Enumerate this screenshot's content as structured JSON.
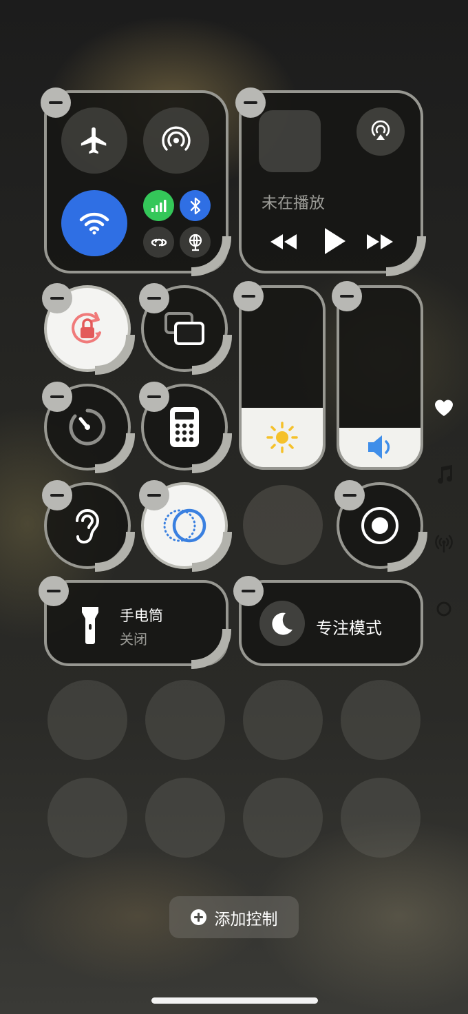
{
  "media": {
    "now_playing": "未在播放"
  },
  "flashlight": {
    "title": "手电筒",
    "status": "关闭"
  },
  "focus": {
    "title": "专注模式"
  },
  "add_control": {
    "label": "添加控制"
  },
  "sliders": {
    "brightness_level": 0.33,
    "volume_level": 0.22
  },
  "icons": {
    "airplane": "airplane-icon",
    "airdrop": "airdrop-icon",
    "wifi": "wifi-icon",
    "cellular": "cellular-signal-icon",
    "bluetooth": "bluetooth-icon",
    "link": "chain-link-icon",
    "satellite": "satellite-globe-icon",
    "airplay": "airplay-audio-icon",
    "rewind": "rewind-icon",
    "play": "play-icon",
    "forward": "fast-forward-icon",
    "rotation_lock": "rotation-lock-icon",
    "screen_mirroring": "screen-mirroring-icon",
    "timer": "timer-icon",
    "calculator": "calculator-icon",
    "hearing": "ear-icon",
    "dark_mode": "dark-mode-icon",
    "screen_recording": "screen-record-icon",
    "flashlight": "flashlight-icon",
    "moon": "moon-icon",
    "sun": "sun-icon",
    "speaker": "speaker-icon",
    "page_favorites": "heart-icon",
    "page_music": "music-note-icon",
    "page_connectivity": "antenna-icon",
    "page_home": "circle-icon"
  },
  "colors": {
    "wifi_blue": "#2f6fe4",
    "cellular_green": "#34c759",
    "bluetooth_blue": "#2f6fe4",
    "rotation_red": "#f07a7a",
    "sun_yellow": "#f5c12a",
    "speaker_blue": "#3f8ee9"
  }
}
